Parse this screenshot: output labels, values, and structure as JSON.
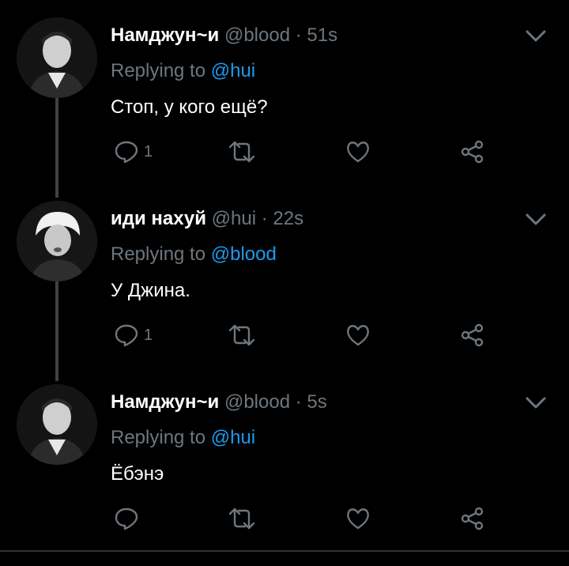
{
  "tweets": [
    {
      "name": "Намджун~и",
      "handle": "@blood",
      "separator": "·",
      "time": "51s",
      "replying_prefix": "Replying to",
      "replying_to": "@hui",
      "text": "Стоп, у кого ещё?",
      "reply_count": "1",
      "avatar": "avatar-namjoon"
    },
    {
      "name": "иди нахуй",
      "handle": "@hui",
      "separator": "·",
      "time": "22s",
      "replying_prefix": "Replying to",
      "replying_to": "@blood",
      "text": "У Джина.",
      "reply_count": "1",
      "avatar": "avatar-yoongi"
    },
    {
      "name": "Намджун~и",
      "handle": "@blood",
      "separator": "·",
      "time": "5s",
      "replying_prefix": "Replying to",
      "replying_to": "@hui",
      "text": "Ёбэнэ",
      "reply_count": "",
      "avatar": "avatar-namjoon"
    }
  ],
  "icons": [
    "reply-icon",
    "retweet-icon",
    "like-icon",
    "share-icon",
    "chevron-down-icon"
  ],
  "colors": {
    "background": "#000000",
    "text": "#ffffff",
    "muted": "#6e767d",
    "link": "#1d9bf0",
    "thread_line": "#3d4246"
  }
}
